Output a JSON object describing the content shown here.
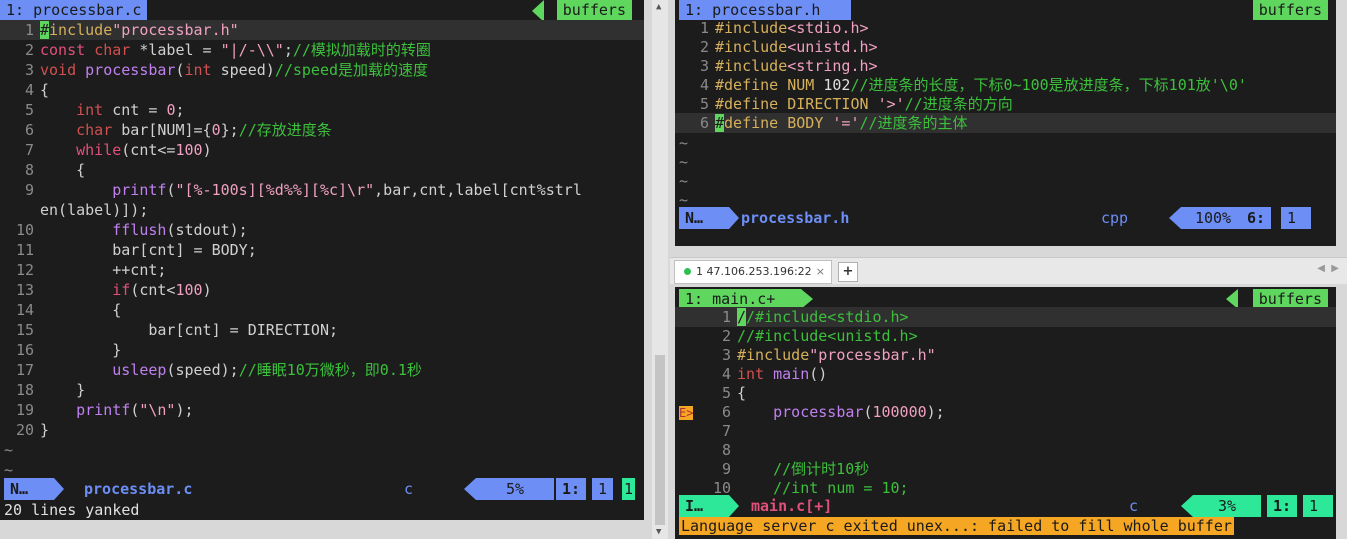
{
  "colors": {
    "accent": "#6c8ef5",
    "tab_green": "#5fd75f",
    "insert_green": "#2ee89a",
    "warning_orange": "#f5a623",
    "bg": "#1c1c1c"
  },
  "left": {
    "tab_label": "1: processbar.c",
    "buffers_label": "buffers",
    "lines": [
      {
        "n": "1",
        "html": "<span class='cursor'>#</span><span class='p'>include</span><span class='s'>\"processbar.h\"</span>"
      },
      {
        "n": "2",
        "html": "<span class='k'>const</span> <span class='t'>char</span> *label = <span class='s'>\"|/-\\\\\"</span>;<span class='c'>//模拟加载时的转圈</span>"
      },
      {
        "n": "3",
        "html": "<span class='t'>void</span> <span class='f'>processbar</span>(<span class='t'>int</span> speed)<span class='c'>//speed是加载的速度</span>"
      },
      {
        "n": "4",
        "html": "{"
      },
      {
        "n": "5",
        "html": "    <span class='t'>int</span> cnt = <span class='s'>0</span>;"
      },
      {
        "n": "6",
        "html": "    <span class='t'>char</span> bar[NUM]={<span class='s'>0</span>};<span class='c'>//存放进度条</span>"
      },
      {
        "n": "7",
        "html": "    <span class='k'>while</span>(cnt&lt;=<span class='s'>100</span>)"
      },
      {
        "n": "8",
        "html": "    {"
      },
      {
        "n": "9",
        "html": "        <span class='f'>printf</span>(<span class='s'>\"[%-100s][%d%%][%c]\\r\"</span>,bar,cnt,label[cnt%strl"
      },
      {
        "n": "",
        "html": "en(label)]);"
      },
      {
        "n": "10",
        "html": "        <span class='f'>fflush</span>(stdout);"
      },
      {
        "n": "11",
        "html": "        bar[cnt] = BODY;"
      },
      {
        "n": "12",
        "html": "        ++cnt;"
      },
      {
        "n": "13",
        "html": "        <span class='k'>if</span>(cnt&lt;<span class='s'>100</span>)"
      },
      {
        "n": "14",
        "html": "        {"
      },
      {
        "n": "15",
        "html": "            bar[cnt] = DIRECTION;"
      },
      {
        "n": "16",
        "html": "        }"
      },
      {
        "n": "17",
        "html": "        <span class='f'>usleep</span>(speed);<span class='c'>//睡眠10万微秒，即0.1秒</span>"
      },
      {
        "n": "18",
        "html": "    }"
      },
      {
        "n": "19",
        "html": "    <span class='f'>printf</span>(<span class='s'>\"\\n\"</span>);"
      },
      {
        "n": "20",
        "html": "}"
      }
    ],
    "status": {
      "mode": "N…",
      "file": "processbar.c",
      "filetype": "c",
      "percent": "5%",
      "line": "1:",
      "col": "1",
      "extra": "1"
    },
    "message": "20 lines yanked"
  },
  "right_top": {
    "tab_label": "1: processbar.h",
    "buffers_label": "buffers",
    "lines": [
      {
        "n": "1",
        "html": "<span class='p'>#include</span><span class='s'>&lt;stdio.h&gt;</span>"
      },
      {
        "n": "2",
        "html": "<span class='p'>#include</span><span class='s'>&lt;unistd.h&gt;</span>"
      },
      {
        "n": "3",
        "html": "<span class='p'>#include</span><span class='s'>&lt;string.h&gt;</span>"
      },
      {
        "n": "4",
        "html": "<span class='p'>#define NUM</span> <span class='n'>102</span><span class='c'>//进度条的长度，下标0~100是放进度条，下标101放'\\0'</span>"
      },
      {
        "n": "5",
        "html": "<span class='p'>#define DIRECTION</span> <span class='s'>'&gt;'</span><span class='c'>//进度条的方向</span>"
      },
      {
        "n": "6",
        "html": "<span class='cursor'>#</span><span class='p'>define BODY</span> <span class='s'>'='</span><span class='c'>//进度条的主体</span>"
      }
    ],
    "status": {
      "mode": "N…",
      "file": "processbar.h",
      "filetype": "cpp",
      "percent": "100%",
      "line": "6:",
      "col": "1"
    }
  },
  "session_tab": {
    "label": "1 47.106.253.196:22",
    "close": "×",
    "add": "+"
  },
  "right_bottom": {
    "tab_label": "1: main.c+",
    "buffers_label": "buffers",
    "lines": [
      {
        "n": "1",
        "sign": "",
        "html": "<span class='cursor'>/</span><span class='c'>/#include&lt;stdio.h&gt;</span>"
      },
      {
        "n": "2",
        "sign": "",
        "html": "<span class='c'>//#include&lt;unistd.h&gt;</span>"
      },
      {
        "n": "3",
        "sign": "",
        "html": "<span class='p'>#include</span><span class='s'>\"processbar.h\"</span>"
      },
      {
        "n": "4",
        "sign": "",
        "html": "<span class='t'>int</span> <span class='f'>main</span>()"
      },
      {
        "n": "5",
        "sign": "",
        "html": "{"
      },
      {
        "n": "6",
        "sign": "E>",
        "html": "    <span class='f'>processbar</span>(<span class='s'>100000</span>);"
      },
      {
        "n": "7",
        "sign": "",
        "html": ""
      },
      {
        "n": "8",
        "sign": "",
        "html": ""
      },
      {
        "n": "9",
        "sign": "",
        "html": "    <span class='c'>//倒计时10秒</span>"
      },
      {
        "n": "10",
        "sign": "",
        "html": "    <span class='c'>//int num = 10;</span>"
      }
    ],
    "status": {
      "mode": "I…",
      "file": "main.c[+]",
      "filetype": "c",
      "percent": "3%",
      "line": "1:",
      "col": "1"
    },
    "warning": "Language server c exited unex...: failed to fill whole buffer"
  }
}
